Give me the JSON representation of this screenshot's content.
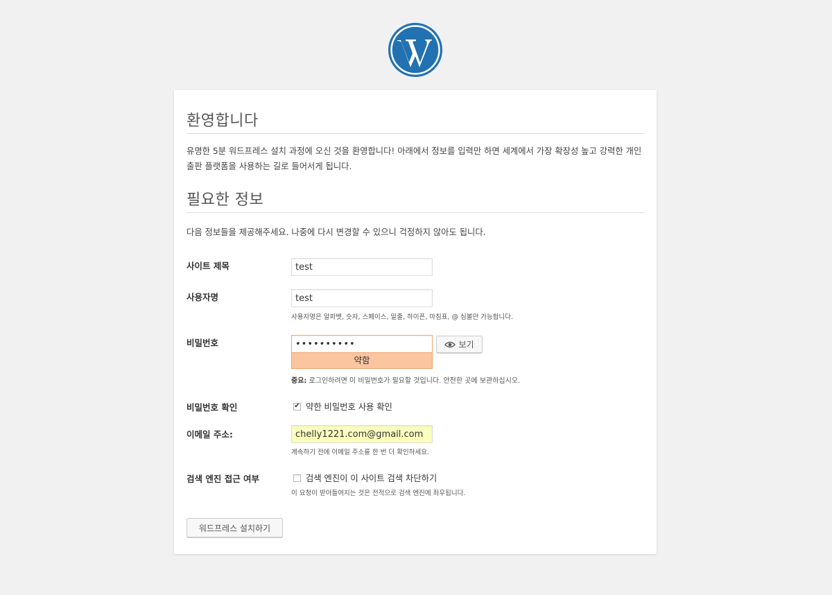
{
  "page": {
    "welcome_heading": "환영합니다",
    "welcome_text": "유명한 5분 워드프레스 설치 과정에 오신 것을 환영합니다! 아래에서 정보를 입력만 하면 세계에서 가장 확장성 높고 강력한 개인 출판 플랫폼을 사용하는 길로 들어서게 됩니다.",
    "required_heading": "필요한 정보",
    "required_text": "다음 정보들을 제공해주세요. 나중에 다시 변경할 수 있으니 걱정하지 않아도 됩니다."
  },
  "form": {
    "site_title": {
      "label": "사이트 제목",
      "value": "test"
    },
    "username": {
      "label": "사용자명",
      "value": "test",
      "hint": "사용자명은 알파벳, 숫자, 스페이스, 밑줄, 하이픈, 마침표, @ 심볼만 가능합니다."
    },
    "password": {
      "label": "비밀번호",
      "value": "••••••••••",
      "show_button": "보기",
      "strength": "약함",
      "hint_strong": "중요:",
      "hint": " 로그인하려면 이 비밀번호가 필요할 것입니다. 안전한 곳에 보관하십시오."
    },
    "confirm": {
      "label": "비밀번호 확인",
      "checkbox_label": "약한 비밀번호 사용 확인",
      "checked": true
    },
    "email": {
      "label": "이메일 주소:",
      "value": "chelly1221.com@gmail.com",
      "hint": "계속하기 전에 이메일 주소를 한 번 더 확인하세요."
    },
    "search": {
      "label": "검색 엔진 접근 여부",
      "checkbox_label": "검색 엔진이 이 사이트 검색 차단하기",
      "checked": false,
      "hint": "이 요청이 받아들여지는 것은 전적으로 검색 엔진에 좌우됩니다."
    },
    "submit": "워드프레스 설치하기"
  },
  "colors": {
    "logo": "#2271b1",
    "background": "#f1f1f1",
    "strength_bg": "#fbc5a0",
    "autofill": "#faffbd"
  },
  "icons": {
    "logo": "wordpress-logo-icon",
    "show": "eye-icon"
  }
}
